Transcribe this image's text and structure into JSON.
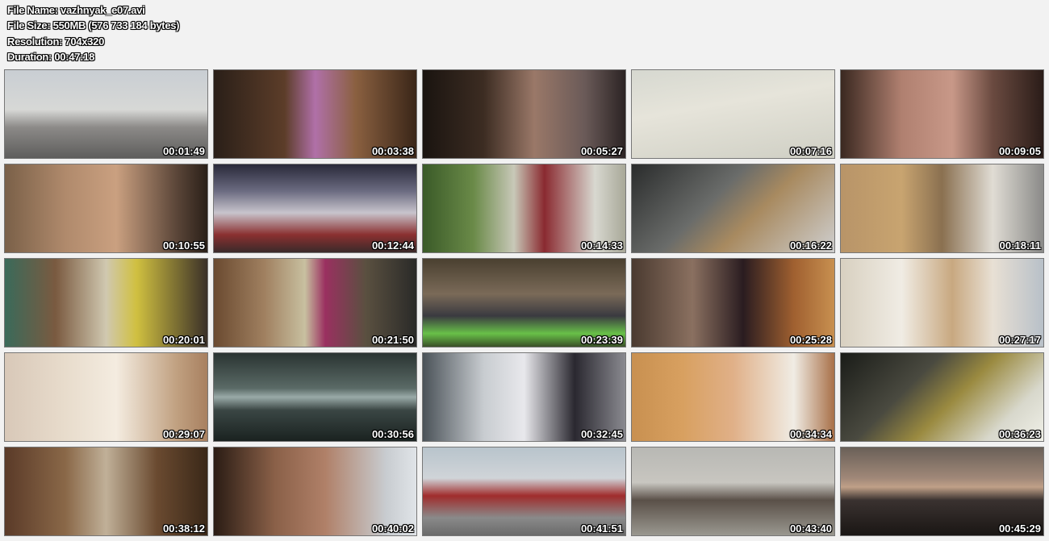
{
  "header": {
    "file_name": "File Name: vazhnyak_e07.avi",
    "file_size": "File Size: 550MB (576 733 184 bytes)",
    "resolution": "Resolution: 704x320",
    "duration": "Duration: 00:47:18"
  },
  "thumbnails": [
    {
      "time": "00:01:49",
      "bg": "linear-gradient(180deg,#c9ced3 0%,#d7d8d6 45%,#8c8a88 65%,#5e5d5c 100%)"
    },
    {
      "time": "00:03:38",
      "bg": "linear-gradient(90deg,#2a1f18 0%,#5c3d29 35%,#b070a8 50%,#8a6040 70%,#3a2618 100%)"
    },
    {
      "time": "00:05:27",
      "bg": "linear-gradient(90deg,#1a1410 0%,#3c2c22 30%,#9a7868 55%,#6a5a58 80%,#2c2424 100%)"
    },
    {
      "time": "00:07:16",
      "bg": "linear-gradient(170deg,#d6d8d0 0%,#e6e4da 40%,#cfcfc4 100%)"
    },
    {
      "time": "00:09:05",
      "bg": "linear-gradient(90deg,#3a2820 0%,#b08070 30%,#c89888 55%,#6a4a40 75%,#2a1c18 100%)"
    },
    {
      "time": "00:10:55",
      "bg": "linear-gradient(90deg,#7a6048 0%,#b08a6c 30%,#caa080 55%,#5a4538 85%,#2a2018 100%)"
    },
    {
      "time": "00:12:44",
      "bg": "linear-gradient(180deg,#2a2a3a 0%,#6a6a80 30%,#c8c4cc 55%,#8a3030 80%,#3a2a2a 100%)"
    },
    {
      "time": "00:14:33",
      "bg": "linear-gradient(90deg,#3a5a28 0%,#6a8a48 25%,#c8c8b8 45%,#8a2a30 60%,#d8d8d0 85%,#a8a898 100%)"
    },
    {
      "time": "00:16:22",
      "bg": "linear-gradient(135deg,#2a2c2c 0%,#6a6c6a 40%,#a88a60 60%,#cfcfcf 100%)"
    },
    {
      "time": "00:18:11",
      "bg": "linear-gradient(90deg,#b89468 0%,#c8a470 30%,#8a7050 50%,#e0dcd4 75%,#8a8a88 100%)"
    },
    {
      "time": "00:20:01",
      "bg": "linear-gradient(90deg,#3a6a5a 0%,#7a5a40 25%,#d0c8b0 50%,#d0c040 65%,#3a3028 100%)"
    },
    {
      "time": "00:21:50",
      "bg": "linear-gradient(90deg,#6a4a30 0%,#a08060 25%,#c8c0a0 45%,#9a3060 55%,#5a5040 75%,#2a2a28 100%)"
    },
    {
      "time": "00:23:39",
      "bg": "linear-gradient(180deg,#4a4030 0%,#7a6a58 40%,#3a3a40 65%,#68c048 85%,#3a5028 100%)"
    },
    {
      "time": "00:25:28",
      "bg": "linear-gradient(90deg,#4a3a30 0%,#8a7060 30%,#2a1c20 55%,#a06030 80%,#c89050 100%)"
    },
    {
      "time": "00:27:17",
      "bg": "linear-gradient(90deg,#d8d0c0 0%,#f0ece4 30%,#c8a880 55%,#e8e0d4 75%,#b8c0c8 100%)"
    },
    {
      "time": "00:29:07",
      "bg": "linear-gradient(90deg,#d8c8b8 0%,#e8dccc 30%,#f4ece0 55%,#c0a080 85%,#a88060 100%)"
    },
    {
      "time": "00:30:56",
      "bg": "linear-gradient(180deg,#2a3432 0%,#5a6a66 40%,#9aaaa8 50%,#3a4644 65%,#1a2220 100%)"
    },
    {
      "time": "00:32:45",
      "bg": "linear-gradient(90deg,#4a5258 0%,#c8ccd0 30%,#e8e8ec 50%,#2a2830 75%,#8a8a90 100%)"
    },
    {
      "time": "00:34:34",
      "bg": "linear-gradient(90deg,#c89050 0%,#d8a060 25%,#e0b088 50%,#f0ece4 80%,#a87048 100%)"
    },
    {
      "time": "00:36:23",
      "bg": "linear-gradient(135deg,#1a1c18 0%,#4a4a40 35%,#9a8a40 55%,#d8d8cc 80%,#f0f0e8 100%)"
    },
    {
      "time": "00:38:12",
      "bg": "linear-gradient(90deg,#5a3a28 0%,#8a6848 30%,#c0b098 50%,#6a4a30 75%,#3a2818 100%)"
    },
    {
      "time": "00:40:02",
      "bg": "linear-gradient(90deg,#2a1c14 0%,#8a6048 30%,#b08068 55%,#c8ccd0 85%,#e0e4e8 100%)"
    },
    {
      "time": "00:41:51",
      "bg": "linear-gradient(180deg,#b8c4cc 0%,#d0d4d8 35%,#a02c2c 55%,#8a8a8a 80%,#6a6a6a 100%)"
    },
    {
      "time": "00:43:40",
      "bg": "linear-gradient(180deg,#b8b8b4 0%,#c8c6c0 40%,#5a5048 60%,#9a9890 100%)"
    },
    {
      "time": "00:45:29",
      "bg": "linear-gradient(180deg,#6a6058 0%,#a08878 35%,#c0a088 45%,#3a3230 60%,#1a1614 100%)"
    }
  ]
}
